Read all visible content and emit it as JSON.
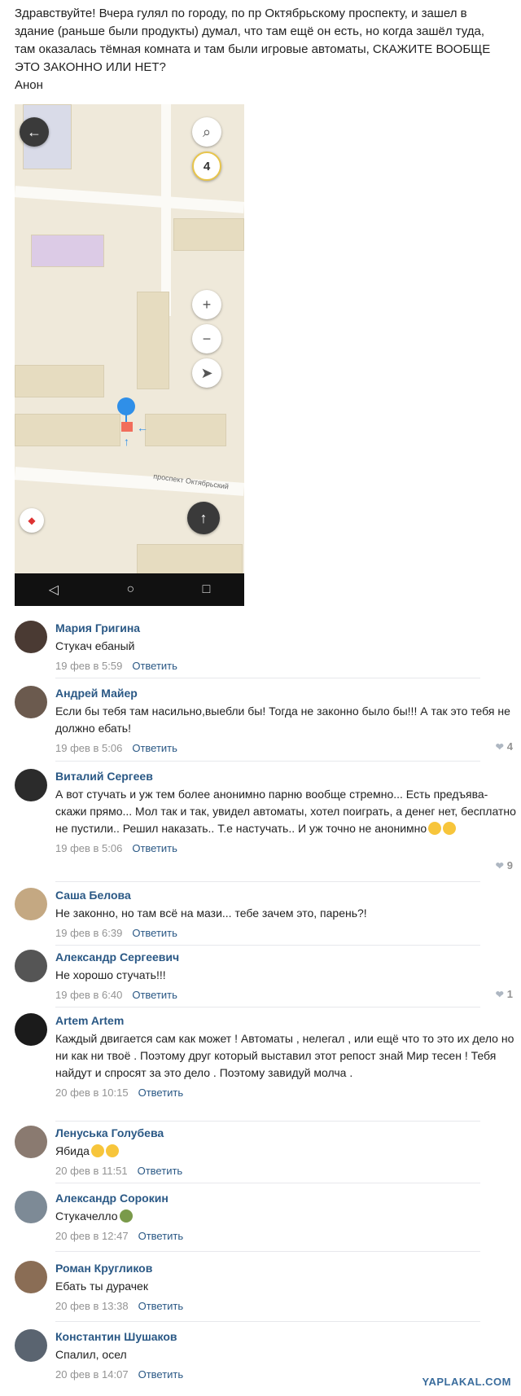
{
  "post": {
    "lines": [
      "Здравствуйте! Вчера гулял по городу, по пр Октябрьскому проспекту, и зашел в",
      "здание (раньше были продукты) думал, что там ещё он есть, но когда зашёл туда,",
      "там оказалась тёмная комната и там были игровые автоматы, СКАЖИТЕ ВООБЩЕ",
      "ЭТО ЗАКОННО ИЛИ НЕТ?",
      "Анон"
    ]
  },
  "map": {
    "street_label": "проспект Октябрьский",
    "counter": "4",
    "buttons": {
      "back": "←",
      "search": "⌕",
      "zoom_in": "+",
      "zoom_out": "−",
      "locate": "➤",
      "up": "↑",
      "compass": "◆"
    },
    "nav": {
      "back": "◁",
      "home": "○",
      "recent": "□"
    },
    "pin_color": "#2f8fe8"
  },
  "comments": [
    {
      "author": "Мария Григина",
      "text": "Стукач ебаный",
      "date": "19 фев в 5:59",
      "reply": "Ответить",
      "likes": "",
      "avatar_color": "#4a3a33"
    },
    {
      "author": "Андрей Майер",
      "text": "Если бы тебя там насильно,выебли бы! Тогда не законно было бы!!! А так это тебя не должно ебать!",
      "date": "19 фев в 5:06",
      "reply": "Ответить",
      "likes": "4",
      "avatar_color": "#6b5a4e"
    },
    {
      "author": "Виталий Сергеев",
      "text": "А вот стучать и уж тем более анонимно парню вообще стремно... Есть предъява- скажи прямо... Мол так и так, увидел автоматы, хотел поиграть, а денег нет, бесплатно не пустили.. Решил наказать.. Т.е настучать.. И уж точно не анонимно",
      "date": "19 фев в 5:06",
      "reply": "Ответить",
      "likes": "9",
      "avatar_color": "#2b2b2b"
    },
    {
      "author": "Саша Белова",
      "text": "Не законно, но там всё на мази... тебе зачем это, парень?!",
      "date": "19 фев в 6:39",
      "reply": "Ответить",
      "likes": "",
      "avatar_color": "#c4a882"
    },
    {
      "author": "Александр Сергеевич",
      "text": "Не хорошо стучать!!!",
      "date": "19 фев в 6:40",
      "reply": "Ответить",
      "likes": "1",
      "avatar_color": "#555555"
    },
    {
      "author": "Artem Artem",
      "text": "Каждый двигается сам как может ! Автоматы , нелегал , или ещё что то это их дело но ни как ни твоё . Поэтому друг который выставил этот репост знай Мир тесен ! Тебя найдут и спросят за это дело . Поэтому завидуй молча .",
      "date": "20 фев в 10:15",
      "reply": "Ответить",
      "likes": "",
      "avatar_color": "#1b1b1b"
    },
    {
      "author": "Ленуська Голубева",
      "text": "Ябида",
      "date": "20 фев в 11:51",
      "reply": "Ответить",
      "likes": "",
      "avatar_color": "#8a7a70"
    },
    {
      "author": "Александр Сорокин",
      "text": "Стукачелло",
      "date": "20 фев в 12:47",
      "reply": "Ответить",
      "likes": "",
      "avatar_color": "#7d8a96"
    },
    {
      "author": "Роман Кругликов",
      "text": "Ебать ты дурачек",
      "date": "20 фев в 13:38",
      "reply": "Ответить",
      "likes": "",
      "avatar_color": "#8a6d55"
    },
    {
      "author": "Константин Шушаков",
      "text": "Спалил, осел",
      "date": "20 фев в 14:07",
      "reply": "Ответить",
      "likes": "",
      "avatar_color": "#5a6470"
    }
  ],
  "watermark": "YAPLAKAL.COM"
}
